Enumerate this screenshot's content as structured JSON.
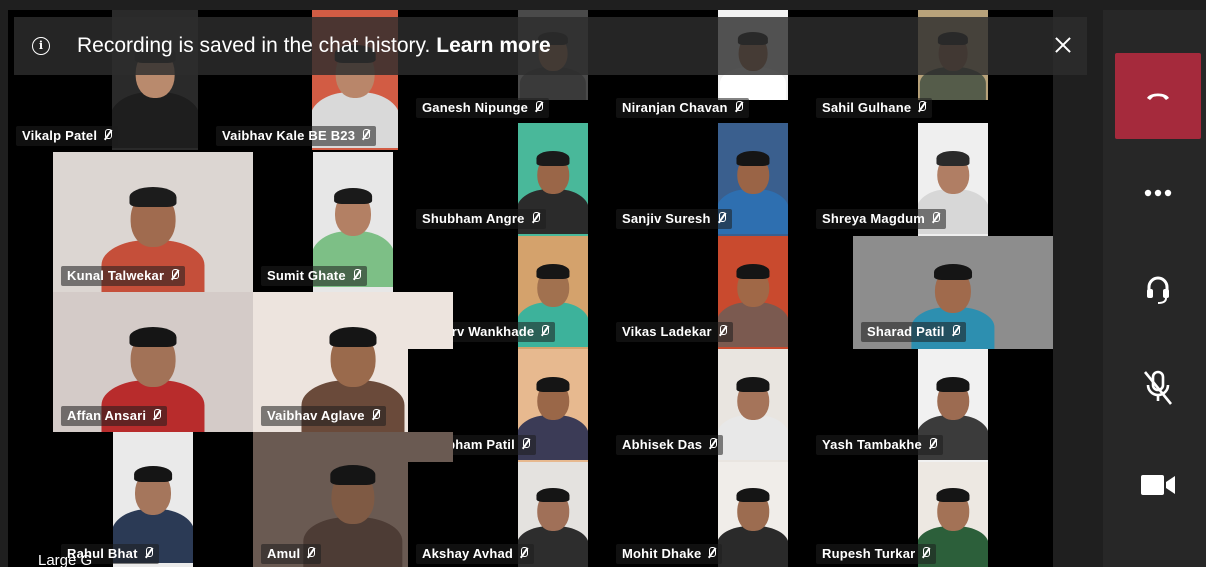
{
  "banner": {
    "message": "Recording is saved in the chat history.",
    "link": "Learn more"
  },
  "bottom_caption": "Large G",
  "controls": [
    {
      "name": "hang-up",
      "icon": "phone-hangup-icon",
      "color": "#a52a3c"
    },
    {
      "name": "more",
      "icon": "more-options-icon"
    },
    {
      "name": "audio",
      "icon": "headset-icon"
    },
    {
      "name": "mute",
      "icon": "mic-off-icon"
    },
    {
      "name": "video",
      "icon": "video-camera-icon"
    }
  ],
  "participants": [
    {
      "id": "p1",
      "name": "Vikalp Patel"
    },
    {
      "id": "p2",
      "name": "Vaibhav Kale BE B23"
    },
    {
      "id": "p3",
      "name": "Ganesh Nipunge"
    },
    {
      "id": "p4",
      "name": "Niranjan Chavan"
    },
    {
      "id": "p5",
      "name": "Sahil Gulhane"
    },
    {
      "id": "p6",
      "name": "Kunal Talwekar"
    },
    {
      "id": "p7",
      "name": "Sumit Ghate"
    },
    {
      "id": "p8",
      "name": "Shubham Angre"
    },
    {
      "id": "p9",
      "name": "Sanjiv Suresh"
    },
    {
      "id": "p10",
      "name": "Shreya Magdum"
    },
    {
      "id": "p11",
      "name": "Atharv Wankhade"
    },
    {
      "id": "p12",
      "name": "Vikas Ladekar"
    },
    {
      "id": "p13",
      "name": "Sharad Patil"
    },
    {
      "id": "p14",
      "name": "Affan Ansari"
    },
    {
      "id": "p15",
      "name": "Vaibhav Aglave"
    },
    {
      "id": "p16",
      "name": "Shubham Patil"
    },
    {
      "id": "p17",
      "name": "Abhisek Das"
    },
    {
      "id": "p18",
      "name": "Yash Tambakhe"
    },
    {
      "id": "p19",
      "name": "Rahul Bhat"
    },
    {
      "id": "p20",
      "name": "Amul"
    },
    {
      "id": "p21",
      "name": "Akshay Avhad"
    },
    {
      "id": "p22",
      "name": "Mohit Dhake"
    },
    {
      "id": "p23",
      "name": "Rupesh Turkar"
    }
  ]
}
